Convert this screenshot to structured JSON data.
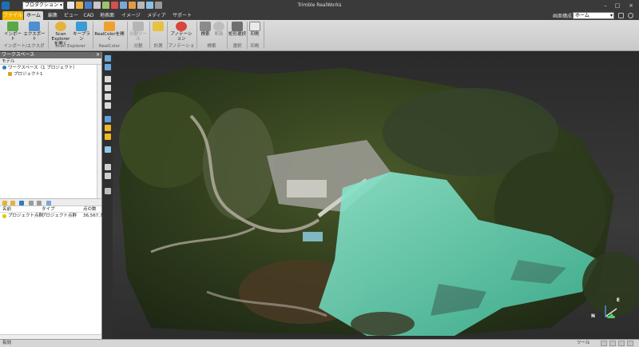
{
  "titlebar": {
    "app_title": "Trimble RealWorks",
    "mode_combo": "プロダクション"
  },
  "tabs": [
    {
      "label": "ファイル"
    },
    {
      "label": "ホーム"
    },
    {
      "label": "編集"
    },
    {
      "label": "ビュー"
    },
    {
      "label": "CAD"
    },
    {
      "label": "地表面"
    },
    {
      "label": "イメージ"
    },
    {
      "label": "メディア"
    },
    {
      "label": "サポート"
    }
  ],
  "workspace_selector": {
    "label": "画面構成",
    "value": "ホーム"
  },
  "ribbon": {
    "buttons": {
      "import": "インポート",
      "export": "エクスポート",
      "scan_explorer": "Scan Explorerを開く",
      "keyplan": "キープラン",
      "realcolor": "RealColorを開く",
      "split_tool": "分割ツール",
      "measure": "計測",
      "annotation": "アノテーション",
      "search": "検索",
      "cross_section": "断面",
      "rect_select": "矩形選択",
      "print": "印刷"
    },
    "groups": {
      "import_export": "インポート/エクスポート",
      "scan_explorer": "Scan Explorer",
      "realcolor": "RealColor",
      "split": "分割",
      "measure": "計測",
      "annotation": "アノテーション",
      "search": "検索",
      "select": "選択",
      "print": "印刷"
    }
  },
  "workspace": {
    "title": "ワークスペース",
    "close": "×",
    "model_label": "モデル",
    "tree": [
      {
        "label": "ワークスペース（1 プロジェクト）"
      },
      {
        "label": "プロジェクト1"
      }
    ],
    "properties": {
      "headers": {
        "name": "名前",
        "type": "タイプ",
        "points": "点の数"
      },
      "rows": [
        {
          "name": "プロジェクト点群",
          "type": "プロジェクト点群",
          "points": "36,567,75"
        }
      ]
    }
  },
  "viewport": {
    "axis_n": "N",
    "axis_e": "E"
  },
  "status": {
    "left": "有効",
    "right": "ツール"
  },
  "colors": {
    "accent_file_tab": "#f2b400",
    "water": "#5fd3b5",
    "ribbon_bg": "#d0d0d0"
  }
}
